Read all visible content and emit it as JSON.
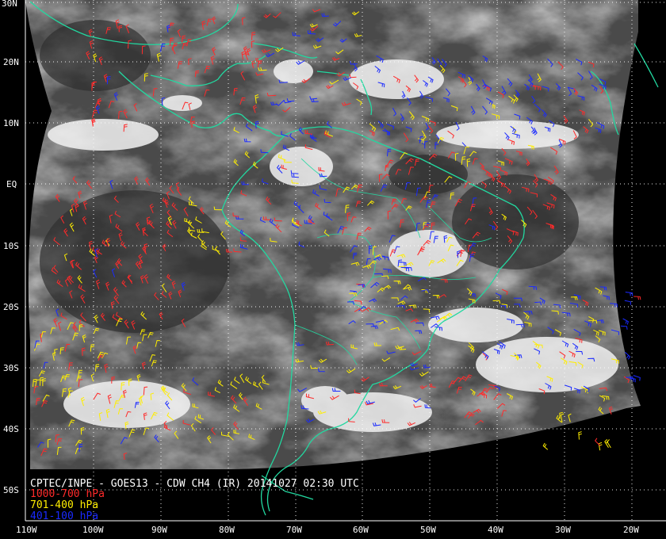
{
  "caption": "CPTEC/INPE - GOES13 - CDW CH4 (IR) 20141027 02:30 UTC",
  "legend": [
    {
      "label": "1000-700 hPa",
      "color": "#ff2a2a"
    },
    {
      "label": "701-400 hPa",
      "color": "#ffee00"
    },
    {
      "label": "401-100 hPa",
      "color": "#1a2aff"
    }
  ],
  "lat_labels": [
    "30N",
    "20N",
    "10N",
    "EQ",
    "10S",
    "20S",
    "30S",
    "40S",
    "50S"
  ],
  "lon_labels": [
    "110W",
    "100W",
    "90W",
    "80W",
    "70W",
    "60W",
    "50W",
    "40W",
    "30W",
    "20W"
  ],
  "colors": {
    "coast": "#22d8a0",
    "grid": "#ffffff",
    "background": "#000000"
  }
}
